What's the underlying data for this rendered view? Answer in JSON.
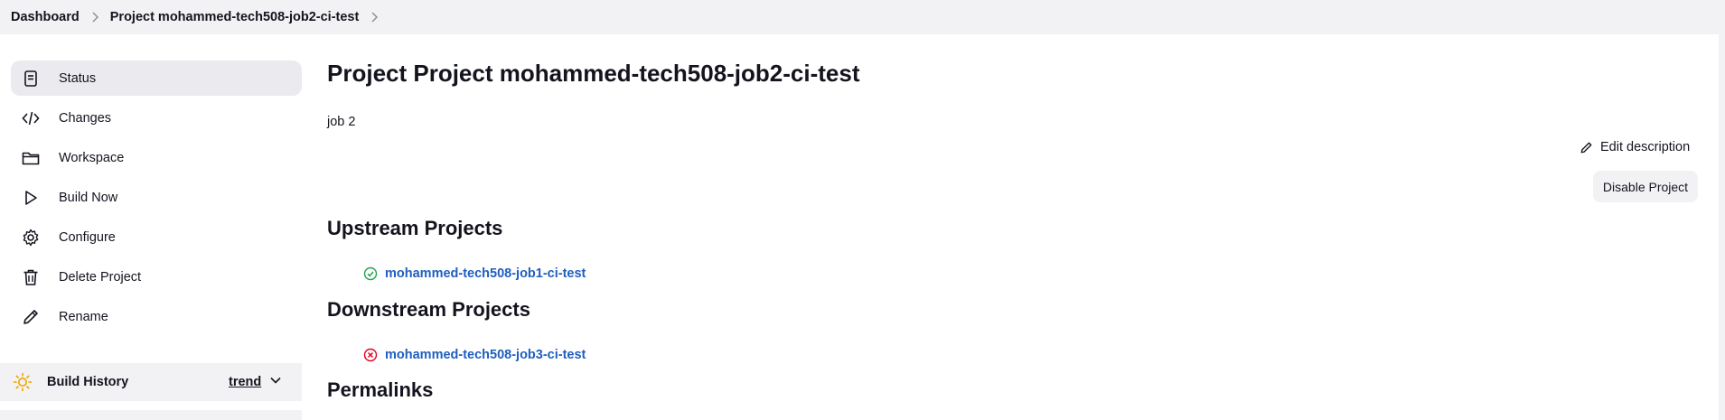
{
  "breadcrumb": {
    "items": [
      "Dashboard",
      "Project mohammed-tech508-job2-ci-test"
    ]
  },
  "sidebar": {
    "items": [
      {
        "label": "Status",
        "icon": "document-icon",
        "active": true
      },
      {
        "label": "Changes",
        "icon": "code-icon"
      },
      {
        "label": "Workspace",
        "icon": "folder-icon"
      },
      {
        "label": "Build Now",
        "icon": "play-icon"
      },
      {
        "label": "Configure",
        "icon": "gear-icon"
      },
      {
        "label": "Delete Project",
        "icon": "trash-icon"
      },
      {
        "label": "Rename",
        "icon": "pencil-icon"
      }
    ],
    "build_history": {
      "label": "Build History",
      "trend_label": "trend",
      "icon": "sun-icon"
    }
  },
  "main": {
    "title": "Project Project mohammed-tech508-job2-ci-test",
    "description": "job 2",
    "edit_description_label": "Edit description",
    "disable_project_label": "Disable Project",
    "upstream": {
      "heading": "Upstream Projects",
      "projects": [
        {
          "name": "mohammed-tech508-job1-ci-test",
          "status": "success"
        }
      ]
    },
    "downstream": {
      "heading": "Downstream Projects",
      "projects": [
        {
          "name": "mohammed-tech508-job3-ci-test",
          "status": "failed"
        }
      ]
    },
    "permalinks_heading": "Permalinks"
  },
  "colors": {
    "link": "#1f5fbf",
    "success": "#1ea64b",
    "failed": "#e6001f",
    "active_bg": "#ebebef",
    "bar_bg": "#f2f2f4"
  }
}
